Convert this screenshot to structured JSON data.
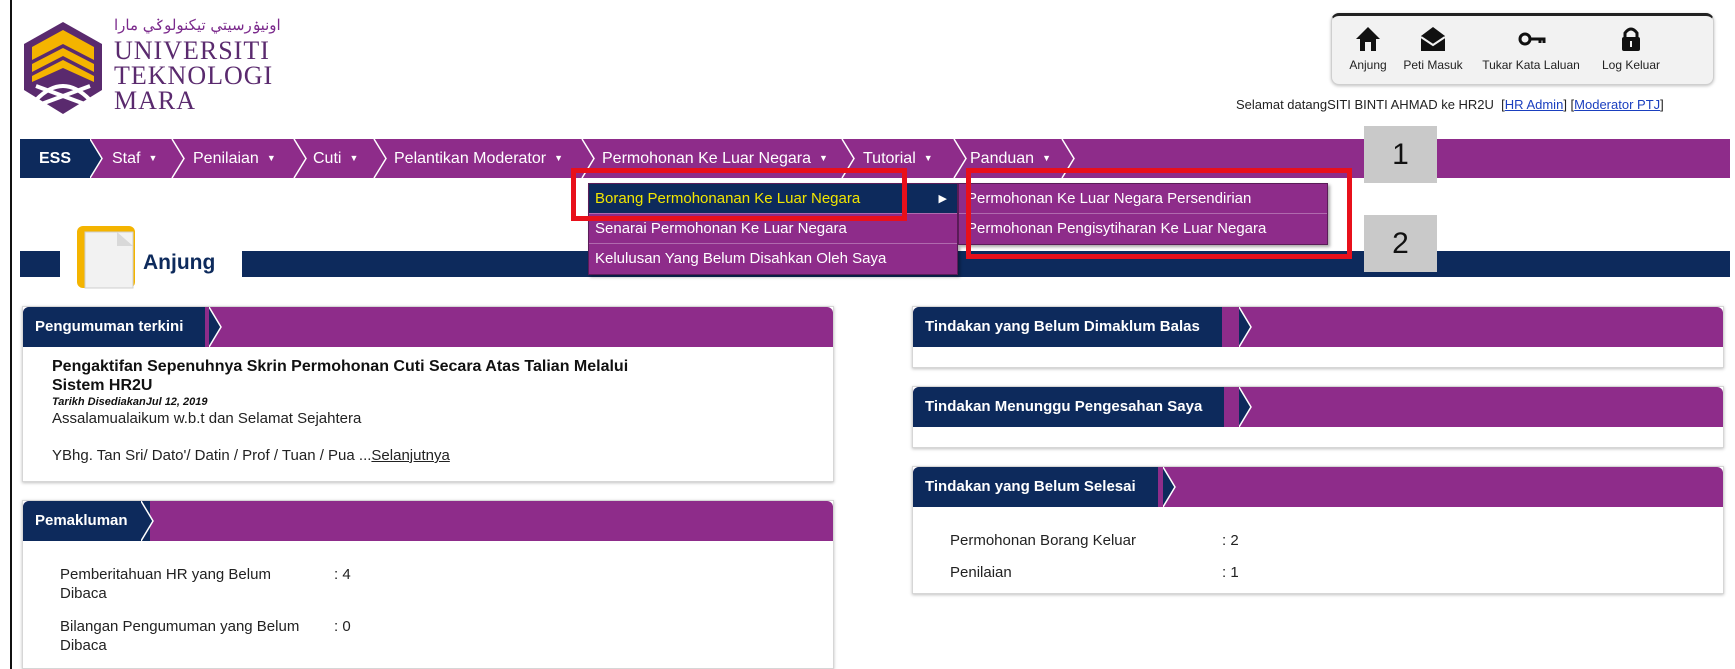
{
  "logo": {
    "jawi": "اونيۏرسيتي تيكنولوݢي مارا",
    "line1": "UNIVERSITI",
    "line2": "TEKNOLOGI",
    "line3": "MARA"
  },
  "toolbar": {
    "home": "Anjung",
    "inbox": "Peti Masuk",
    "password": "Tukar Kata Laluan",
    "logout": "Log Keluar"
  },
  "welcome": {
    "text": "Selamat datangSITI BINTI AHMAD ke HR2U",
    "link1": "HR Admin",
    "link2": "Moderator PTJ"
  },
  "nav": {
    "ess": "ESS",
    "items": [
      "Staf",
      "Penilaian",
      "Cuti",
      "Pelantikan Moderator",
      "Permohonan Ke Luar Negara",
      "Tutorial",
      "Panduan"
    ]
  },
  "dropdown": {
    "items": [
      "Borang Permohonanan Ke Luar Negara",
      "Senarai Permohonan Ke Luar Negara",
      "Kelulusan Yang Belum Disahkan Oleh Saya"
    ],
    "submenu": [
      "Permohonan Ke Luar Negara Persendirian",
      "Permohonan Pengisytiharan Ke Luar Negara"
    ]
  },
  "callouts": [
    "1",
    "2"
  ],
  "page": {
    "title": "Anjung"
  },
  "announcements": {
    "header": "Pengumuman terkini",
    "title": "Pengaktifan Sepenuhnya Skrin Permohonan Cuti Secara Atas Talian Melalui Sistem HR2U",
    "date": "Tarikh DisediakanJul 12, 2019",
    "line1": "Assalamualaikum w.b.t dan Selamat Sejahtera",
    "line2": "YBhg. Tan Sri/ Dato'/ Datin / Prof / Tuan / Pua ...",
    "more": "Selanjutnya"
  },
  "notices": {
    "header": "Pemakluman",
    "rows": [
      {
        "label": "Pemberitahuan HR yang Belum Dibaca",
        "value": ": 4"
      },
      {
        "label": "Bilangan Pengumuman yang Belum Dibaca",
        "value": ": 0"
      }
    ]
  },
  "right": {
    "p1": "Tindakan yang Belum Dimaklum Balas",
    "p2": "Tindakan Menunggu Pengesahan Saya",
    "p3": "Tindakan yang Belum Selesai",
    "rows": [
      {
        "label": "Permohonan Borang Keluar",
        "value": ": 2"
      },
      {
        "label": "Penilaian",
        "value": ": 1"
      }
    ]
  },
  "colors": {
    "purple": "#8e2c8a",
    "navy": "#0d2a5c",
    "highlight": "#e8101b"
  }
}
